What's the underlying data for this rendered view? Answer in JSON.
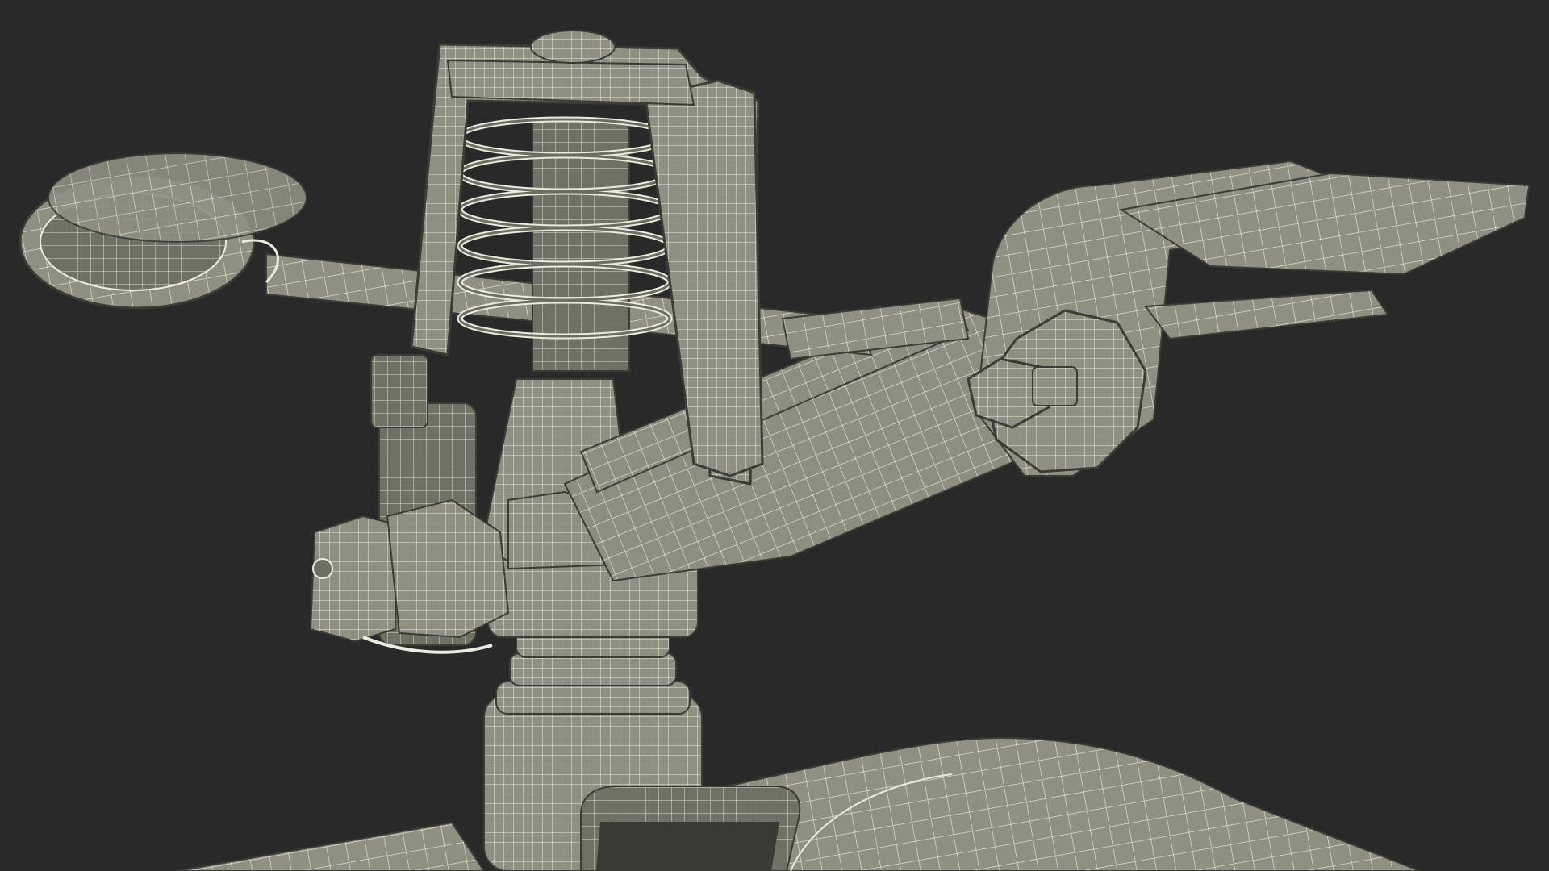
{
  "scene": {
    "subject": "impact-sprinkler-wireframe",
    "colors": {
      "background": "#292929",
      "surface": "#8b8c7d",
      "surface_light": "#a3a496",
      "surface_dark": "#6d6e62",
      "edge": "#3b3c35",
      "wire": "#ecebdf"
    }
  }
}
